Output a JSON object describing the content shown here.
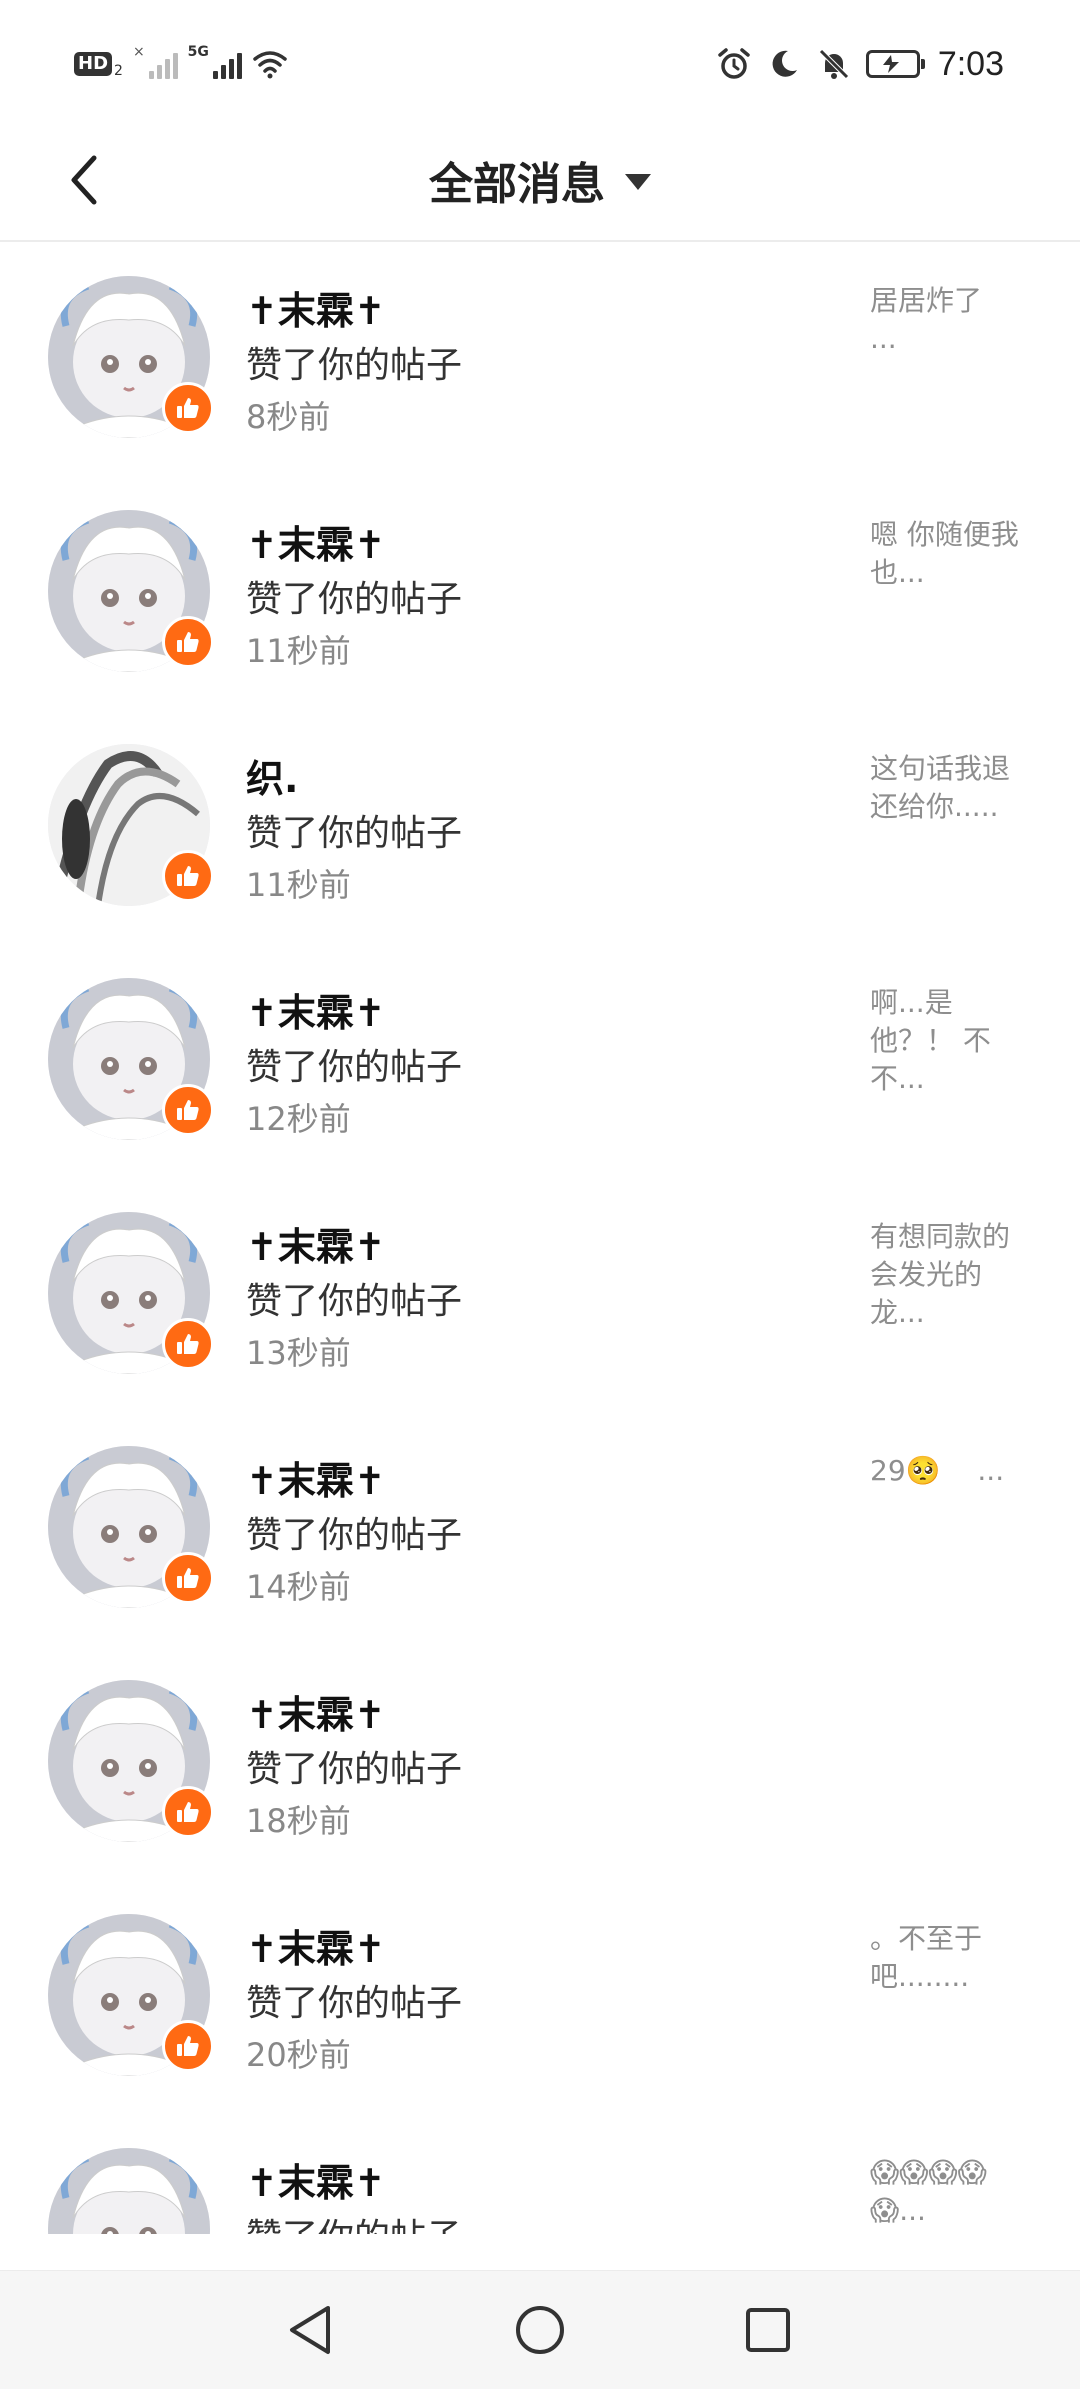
{
  "status_bar": {
    "time": "7:03",
    "hd": "HD",
    "hd_sub": "2",
    "network": "5G",
    "icons": [
      "hd-icon",
      "signal-icon",
      "signal-5g-icon",
      "wifi-icon",
      "alarm-icon",
      "moon-icon",
      "bell-off-icon",
      "battery-charging-icon"
    ]
  },
  "header": {
    "title": "全部消息",
    "back_icon": "back-icon",
    "dropdown_icon": "caret-down-icon"
  },
  "notifications": [
    {
      "user": "✝末霖✝",
      "action": "赞了你的帖子",
      "time": "8秒前",
      "preview": "居居炸了　 ..."
    },
    {
      "user": "✝末霖✝",
      "action": "赞了你的帖子",
      "time": "11秒前",
      "preview": "嗯 你随便我也..."
    },
    {
      "user": "织.",
      "action": "赞了你的帖子",
      "time": "11秒前",
      "preview": "这句话我退还给你....."
    },
    {
      "user": "✝末霖✝",
      "action": "赞了你的帖子",
      "time": "12秒前",
      "preview": "啊...是他？！ 不不..."
    },
    {
      "user": "✝末霖✝",
      "action": "赞了你的帖子",
      "time": "13秒前",
      "preview": "有想同款的会发光的龙..."
    },
    {
      "user": "✝末霖✝",
      "action": "赞了你的帖子",
      "time": "14秒前",
      "preview": "29🥺　 ..."
    },
    {
      "user": "✝末霖✝",
      "action": "赞了你的帖子",
      "time": "18秒前",
      "preview": ""
    },
    {
      "user": "✝末霖✝",
      "action": "赞了你的帖子",
      "time": "20秒前",
      "preview": "。不至于吧........"
    },
    {
      "user": "✝末霖✝",
      "action": "赞了你的帖子",
      "time": "",
      "preview": "😱😱😱😱😱..."
    }
  ],
  "navbar": {
    "icons": [
      "nav-back-icon",
      "nav-home-icon",
      "nav-recents-icon"
    ]
  },
  "colors": {
    "accent": "#ff6a13",
    "text_primary": "#111111",
    "text_secondary": "#888888"
  }
}
